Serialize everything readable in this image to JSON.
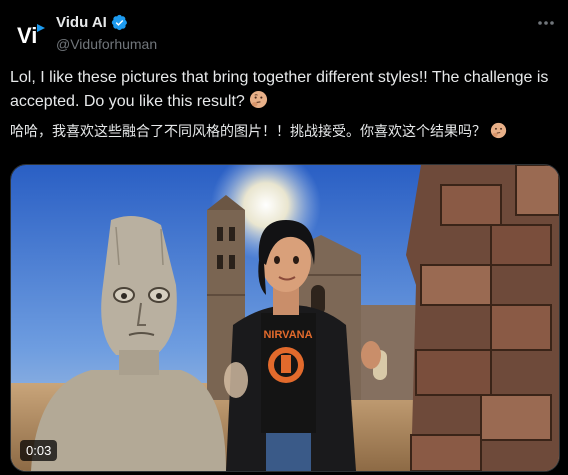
{
  "tweet": {
    "author": {
      "display_name": "Vidu AI",
      "handle": "@Viduforhuman",
      "avatar_text": "Vi",
      "verified": true
    },
    "text_en": "Lol, I like these pictures that bring together different styles!! The challenge is accepted. Do you like this result?",
    "text_zh": "哈哈，我喜欢这些融合了不同风格的图片！！挑战接受。你喜欢这个结果吗？",
    "emoji": "thinking-face",
    "video": {
      "timestamp": "0:03",
      "shirt_text": "NIRVANA"
    }
  },
  "colors": {
    "background": "#000000",
    "text": "#e7e9ea",
    "muted": "#71767b",
    "verified_blue": "#1d9bf0"
  }
}
